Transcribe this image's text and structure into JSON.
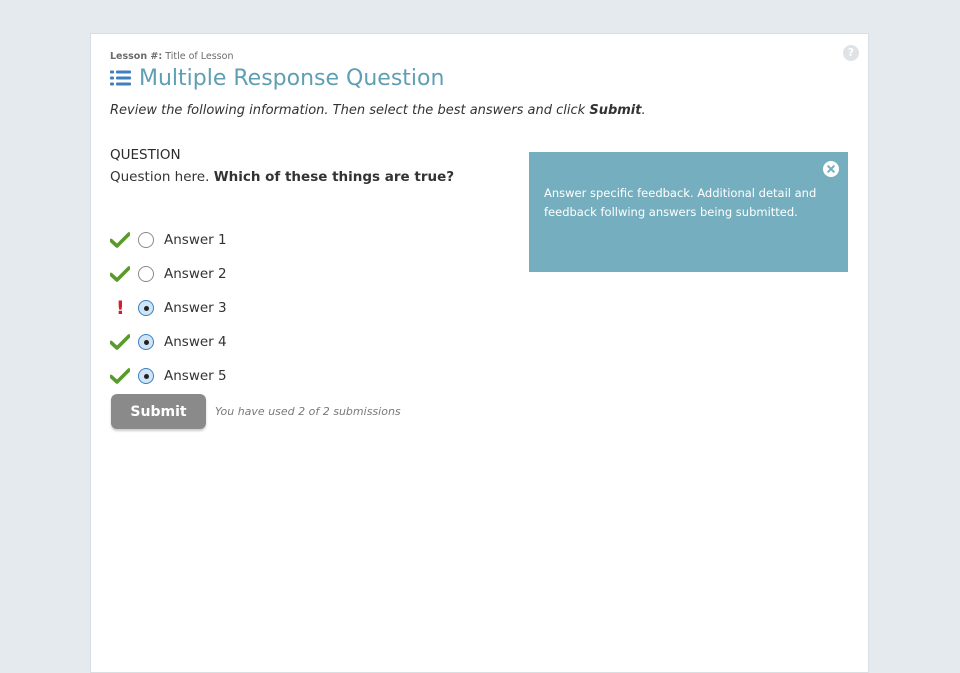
{
  "lesson": {
    "label": "Lesson #:",
    "title": "Title of Lesson"
  },
  "page": {
    "title": "Multiple Response Question",
    "title_icon": "list-icon"
  },
  "instructions": {
    "text": "Review the following information. Then select the best answers and click ",
    "emphasis": "Submit",
    "suffix": "."
  },
  "question": {
    "heading": "QUESTION",
    "text": "Question here. ",
    "prompt": "Which of these things are true?"
  },
  "answers": [
    {
      "label": "Answer 1",
      "selected": false,
      "status": "check-icon"
    },
    {
      "label": "Answer 2",
      "selected": false,
      "status": "check-icon"
    },
    {
      "label": "Answer 3",
      "selected": true,
      "status": "exclamation-icon"
    },
    {
      "label": "Answer 4",
      "selected": true,
      "status": "check-icon"
    },
    {
      "label": "Answer 5",
      "selected": true,
      "status": "check-icon"
    }
  ],
  "submit": {
    "label": "Submit",
    "submissions_text": "You have used 2 of 2 submissions"
  },
  "feedback": {
    "text": "Answer specific feedback. Additional detail and feedback follwing answers being submitted."
  },
  "colors": {
    "accent": "#5f9fb3",
    "feedback_bg": "#75afbf",
    "correct": "#5a9a2a",
    "incorrect": "#d0202b",
    "button": "#8a8a8a"
  }
}
